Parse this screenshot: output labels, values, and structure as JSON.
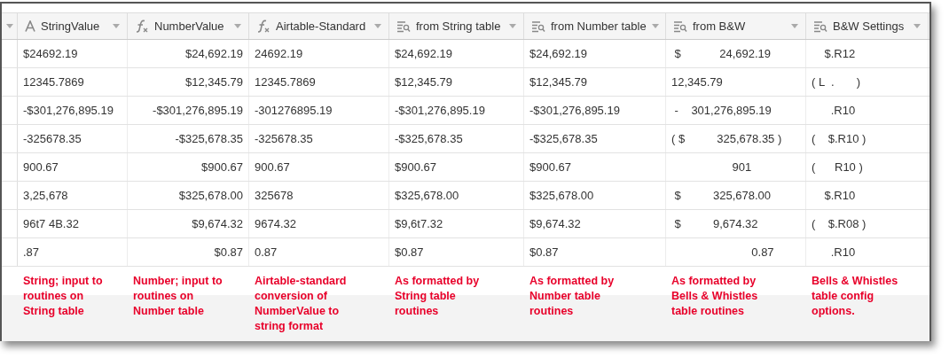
{
  "columns": [
    {
      "label": "StringValue",
      "kind": "text"
    },
    {
      "label": "NumberValue",
      "kind": "numberformula"
    },
    {
      "label": "Airtable-Standard",
      "kind": "textformula"
    },
    {
      "label": "from String table",
      "kind": "lookup"
    },
    {
      "label": "from Number table",
      "kind": "lookup"
    },
    {
      "label": "from B&W",
      "kind": "lookup"
    },
    {
      "label": "B&W Settings",
      "kind": "lookup"
    }
  ],
  "rows": [
    [
      "$24692.19",
      "$24,692.19",
      "24692.19",
      "$24,692.19",
      "$24,692.19",
      " $            24,692.19",
      "    $.R12"
    ],
    [
      "12345.7869",
      "$12,345.79",
      "12345.7869",
      "$12,345.79",
      "$12,345.79",
      "12,345.79",
      "( L  .       )"
    ],
    [
      "-$301,276,895.19",
      "-$301,276,895.19",
      "-301276895.19",
      "-$301,276,895.19",
      "-$301,276,895.19",
      " -    301,276,895.19",
      "      .R10"
    ],
    [
      "-325678.35",
      "-$325,678.35",
      "-325678.35",
      "-$325,678.35",
      "-$325,678.35",
      "( $          325,678.35 )",
      "(    $.R10 )"
    ],
    [
      "900.67",
      "$900.67",
      "900.67",
      "$900.67",
      "$900.67",
      "                   901",
      "(      R10 )"
    ],
    [
      "3,25,678",
      "$325,678.00",
      "325678",
      "$325,678.00",
      "$325,678.00",
      " $          325,678.00",
      "    $.R10"
    ],
    [
      "96t7 4B.32",
      "$9,674.32",
      "9674.32",
      "$9,6t7.32",
      "$9,674.32",
      " $          9,674.32",
      "(    $.R08 )"
    ],
    [
      ".87",
      "$0.87",
      "0.87",
      "$0.87",
      "$0.87",
      "                         0.87",
      "      .R10"
    ]
  ],
  "annotations": [
    "String; input to\nroutines on\nString table",
    "Number; input to\nroutines on\nNumber table",
    "Airtable-standard\nconversion of\nNumberValue to\nstring format",
    "As formatted by\nString table\nroutines",
    "As formatted by\nNumber table\nroutines",
    "As formatted by\nBells & Whistles\ntable routines",
    "Bells & Whistles\ntable config\noptions."
  ]
}
